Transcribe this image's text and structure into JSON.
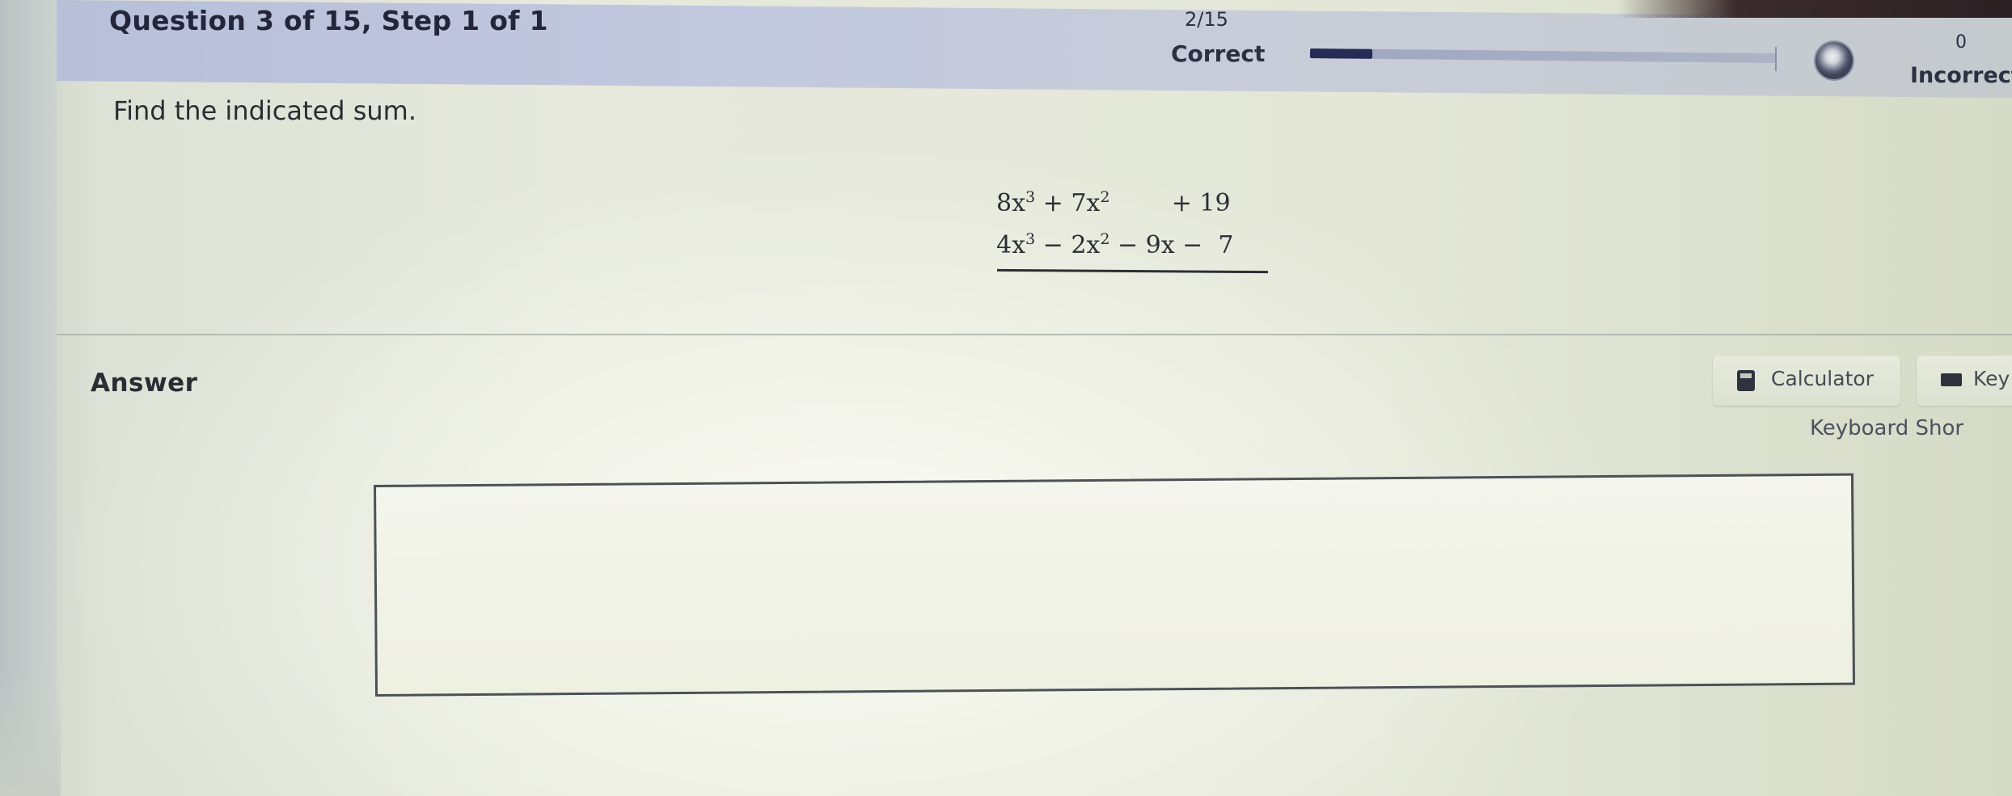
{
  "header": {
    "question_title": "Question 3 of 15,  Step 1 of 1",
    "score_count": "2/15",
    "correct_label": "Correct",
    "progress_fraction": 0.1333,
    "incorrect_count": "0",
    "incorrect_label": "Incorrect"
  },
  "question": {
    "instruction": "Find the indicated sum.",
    "addend_1": {
      "a_coef": "8x",
      "a_exp": "3",
      "b_coef": " + 7x",
      "b_exp": "2",
      "rest": "        + 19"
    },
    "addend_2": {
      "a_coef": "4x",
      "a_exp": "3",
      "b_coef": " − 2x",
      "b_exp": "2",
      "rest": " − 9x −  7"
    }
  },
  "answer": {
    "heading": "Answer",
    "calculator_label": "Calculator",
    "keypad_label": "Key",
    "keyboard_shortcuts_label": "Keyboard Shor",
    "input_value": ""
  },
  "colors": {
    "progress_fill": "#262c55",
    "text_dark": "#2a2d33"
  }
}
